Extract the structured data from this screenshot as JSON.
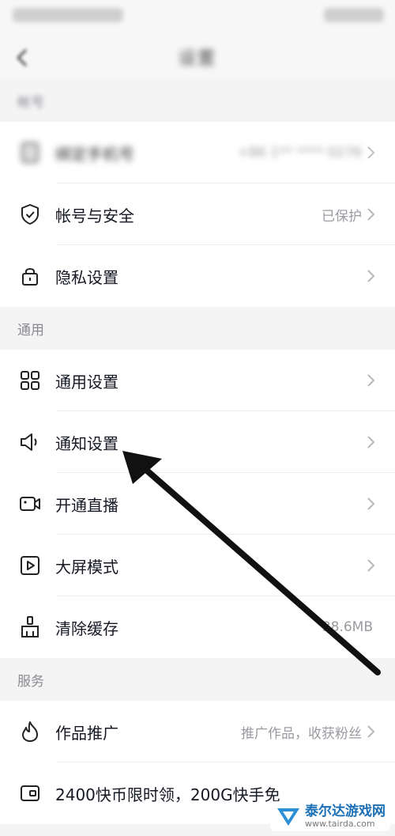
{
  "nav": {
    "title": "设置"
  },
  "account_section": {
    "header": "帐号",
    "rows": [
      {
        "label": "绑定手机号",
        "value": "+86 1** **** 0276"
      }
    ]
  },
  "items_top": [
    {
      "label": "帐号与安全",
      "value": "已保护",
      "icon": "shield-icon"
    },
    {
      "label": "隐私设置",
      "value": "",
      "icon": "lock-icon"
    }
  ],
  "general_section": {
    "header": "通用",
    "rows": [
      {
        "label": "通用设置",
        "value": "",
        "icon": "grid-icon"
      },
      {
        "label": "通知设置",
        "value": "",
        "icon": "speaker-icon"
      },
      {
        "label": "开通直播",
        "value": "",
        "icon": "camera-icon"
      },
      {
        "label": "大屏模式",
        "value": "",
        "icon": "play-square-icon"
      },
      {
        "label": "清除缓存",
        "value": "38.6MB",
        "icon": "broom-icon"
      }
    ]
  },
  "service_section": {
    "header": "服务",
    "rows": [
      {
        "label": "作品推广",
        "value": "推广作品，收获粉丝",
        "icon": "flame-icon"
      },
      {
        "label": "2400快币限时领，200G快手免",
        "value": "",
        "icon": "card-icon"
      }
    ]
  },
  "watermark": {
    "title": "泰尔达游戏网",
    "url": "www.tairda.com"
  },
  "colors": {
    "background": "#f4f4f5",
    "row_bg": "#ffffff",
    "arrow": "#111111"
  }
}
